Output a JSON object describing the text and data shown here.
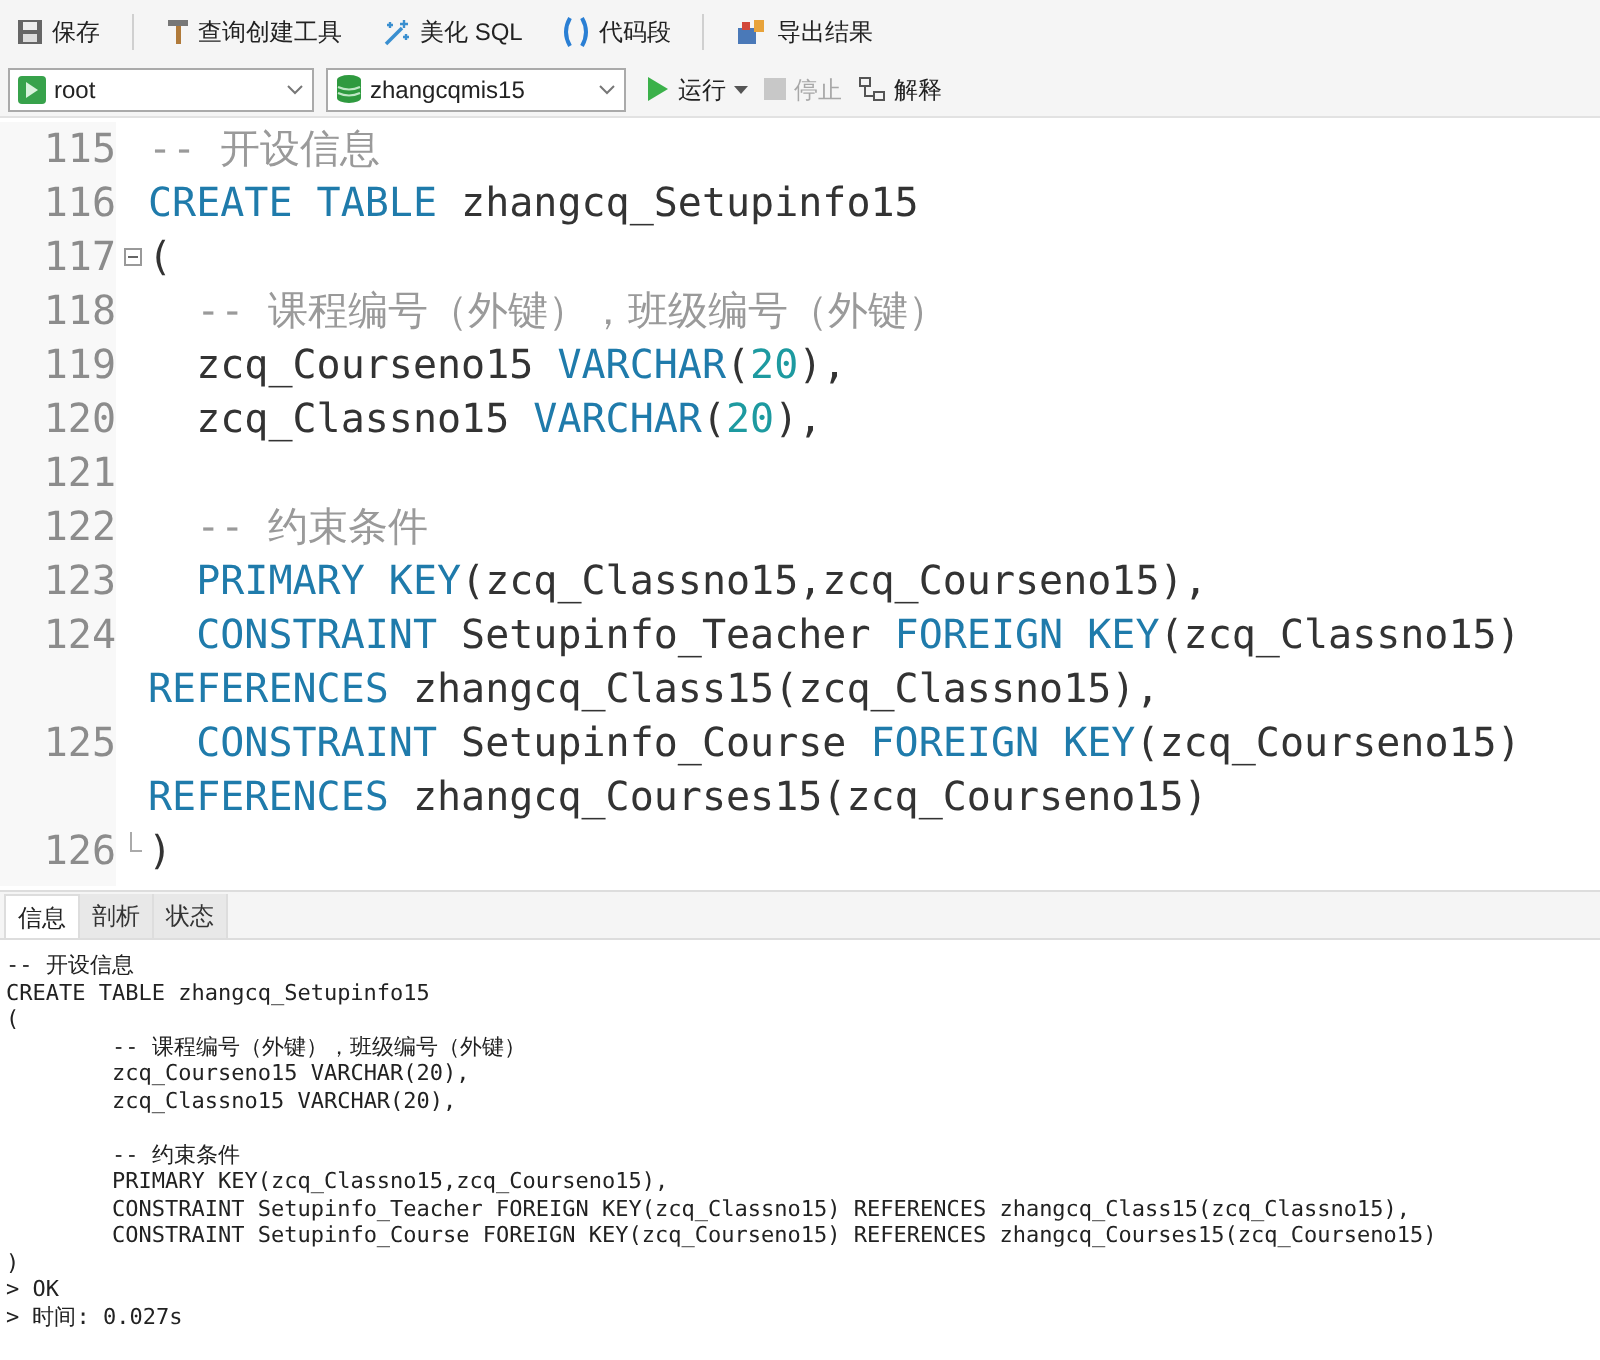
{
  "toolbar": {
    "buttons": [
      {
        "label": "保存",
        "kind": "save"
      },
      {
        "label": "查询创建工具",
        "kind": "builder"
      },
      {
        "label": "美化 SQL",
        "kind": "beautify"
      },
      {
        "label": "代码段",
        "kind": "snippet"
      },
      {
        "label": "导出结果",
        "kind": "export"
      }
    ]
  },
  "connection_bar": {
    "selects": [
      {
        "value": "root",
        "kind": "connection"
      },
      {
        "value": "zhangcqmis15",
        "kind": "database"
      }
    ],
    "actions": [
      {
        "label": "运行",
        "kind": "run",
        "disabled": false,
        "has_menu": true
      },
      {
        "label": "停止",
        "kind": "stop",
        "disabled": true,
        "has_menu": false
      },
      {
        "label": "解释",
        "kind": "explain",
        "disabled": false,
        "has_menu": false
      }
    ]
  },
  "editor": {
    "lines": [
      {
        "number": "115",
        "fold_start": false,
        "fold_end": false,
        "rows": [
          [
            {
              "kind": "comment",
              "text": "-- 开设信息"
            }
          ]
        ]
      },
      {
        "number": "116",
        "fold_start": false,
        "fold_end": false,
        "rows": [
          [
            {
              "kind": "keyword",
              "text": "CREATE TABLE"
            },
            {
              "kind": "plain",
              "text": " zhangcq_Setupinfo15"
            }
          ]
        ]
      },
      {
        "number": "117",
        "fold_start": true,
        "fold_end": false,
        "rows": [
          [
            {
              "kind": "plain",
              "text": "("
            }
          ]
        ]
      },
      {
        "number": "118",
        "fold_start": false,
        "fold_end": false,
        "rows": [
          [
            {
              "kind": "comment",
              "text": "  -- 课程编号（外键），班级编号（外键）"
            }
          ]
        ]
      },
      {
        "number": "119",
        "fold_start": false,
        "fold_end": false,
        "rows": [
          [
            {
              "kind": "plain",
              "text": "  zcq_Courseno15 "
            },
            {
              "kind": "keyword",
              "text": "VARCHAR"
            },
            {
              "kind": "plain",
              "text": "("
            },
            {
              "kind": "number",
              "text": "20"
            },
            {
              "kind": "plain",
              "text": "),"
            }
          ]
        ]
      },
      {
        "number": "120",
        "fold_start": false,
        "fold_end": false,
        "rows": [
          [
            {
              "kind": "plain",
              "text": "  zcq_Classno15 "
            },
            {
              "kind": "keyword",
              "text": "VARCHAR"
            },
            {
              "kind": "plain",
              "text": "("
            },
            {
              "kind": "number",
              "text": "20"
            },
            {
              "kind": "plain",
              "text": "),"
            }
          ]
        ]
      },
      {
        "number": "121",
        "fold_start": false,
        "fold_end": false
      },
      {
        "number": "122",
        "fold_start": false,
        "fold_end": false,
        "rows": [
          [
            {
              "kind": "comment",
              "text": "  -- 约束条件"
            }
          ]
        ]
      },
      {
        "number": "123",
        "fold_start": false,
        "fold_end": false,
        "rows": [
          [
            {
              "kind": "keyword",
              "text": "  PRIMARY KEY"
            },
            {
              "kind": "plain",
              "text": "(zcq_Classno15,zcq_Courseno15),"
            }
          ]
        ]
      },
      {
        "number": "124",
        "fold_start": false,
        "fold_end": false,
        "rows": [
          [
            {
              "kind": "keyword",
              "text": "  CONSTRAINT"
            },
            {
              "kind": "plain",
              "text": " Setupinfo_Teacher "
            },
            {
              "kind": "keyword",
              "text": "FOREIGN KEY"
            },
            {
              "kind": "plain",
              "text": "(zcq_Classno15)"
            }
          ],
          [
            {
              "kind": "keyword",
              "text": "REFERENCES"
            },
            {
              "kind": "plain",
              "text": " zhangcq_Class15(zcq_Classno15),"
            }
          ]
        ]
      },
      {
        "number": "125",
        "fold_start": false,
        "fold_end": false,
        "rows": [
          [
            {
              "kind": "keyword",
              "text": "  CONSTRAINT"
            },
            {
              "kind": "plain",
              "text": " Setupinfo_Course "
            },
            {
              "kind": "keyword",
              "text": "FOREIGN KEY"
            },
            {
              "kind": "plain",
              "text": "(zcq_Courseno15)"
            }
          ],
          [
            {
              "kind": "keyword",
              "text": "REFERENCES"
            },
            {
              "kind": "plain",
              "text": " zhangcq_Courses15(zcq_Courseno15)"
            }
          ]
        ]
      },
      {
        "number": "126",
        "fold_start": false,
        "fold_end": true,
        "rows": [
          [
            {
              "kind": "plain",
              "text": ")"
            }
          ]
        ]
      }
    ]
  },
  "result_tabs": [
    {
      "label": "信息",
      "selected": true
    },
    {
      "label": "剖析",
      "selected": false
    },
    {
      "label": "状态",
      "selected": false
    }
  ],
  "output": {
    "blocks": [
      [
        "-- 开设信息",
        "CREATE TABLE zhangcq_Setupinfo15",
        "(",
        "\t-- 课程编号（外键），班级编号（外键）",
        "\tzcq_Courseno15 VARCHAR(20),",
        "\tzcq_Classno15 VARCHAR(20),"
      ],
      [
        "\t-- 约束条件",
        "\tPRIMARY KEY(zcq_Classno15,zcq_Courseno15),",
        "\tCONSTRAINT Setupinfo_Teacher FOREIGN KEY(zcq_Classno15) REFERENCES zhangcq_Class15(zcq_Classno15),",
        "\tCONSTRAINT Setupinfo_Course FOREIGN KEY(zcq_Courseno15) REFERENCES zhangcq_Courses15(zcq_Courseno15)",
        ")",
        "> OK",
        "> 时间: 0.027s"
      ]
    ]
  }
}
